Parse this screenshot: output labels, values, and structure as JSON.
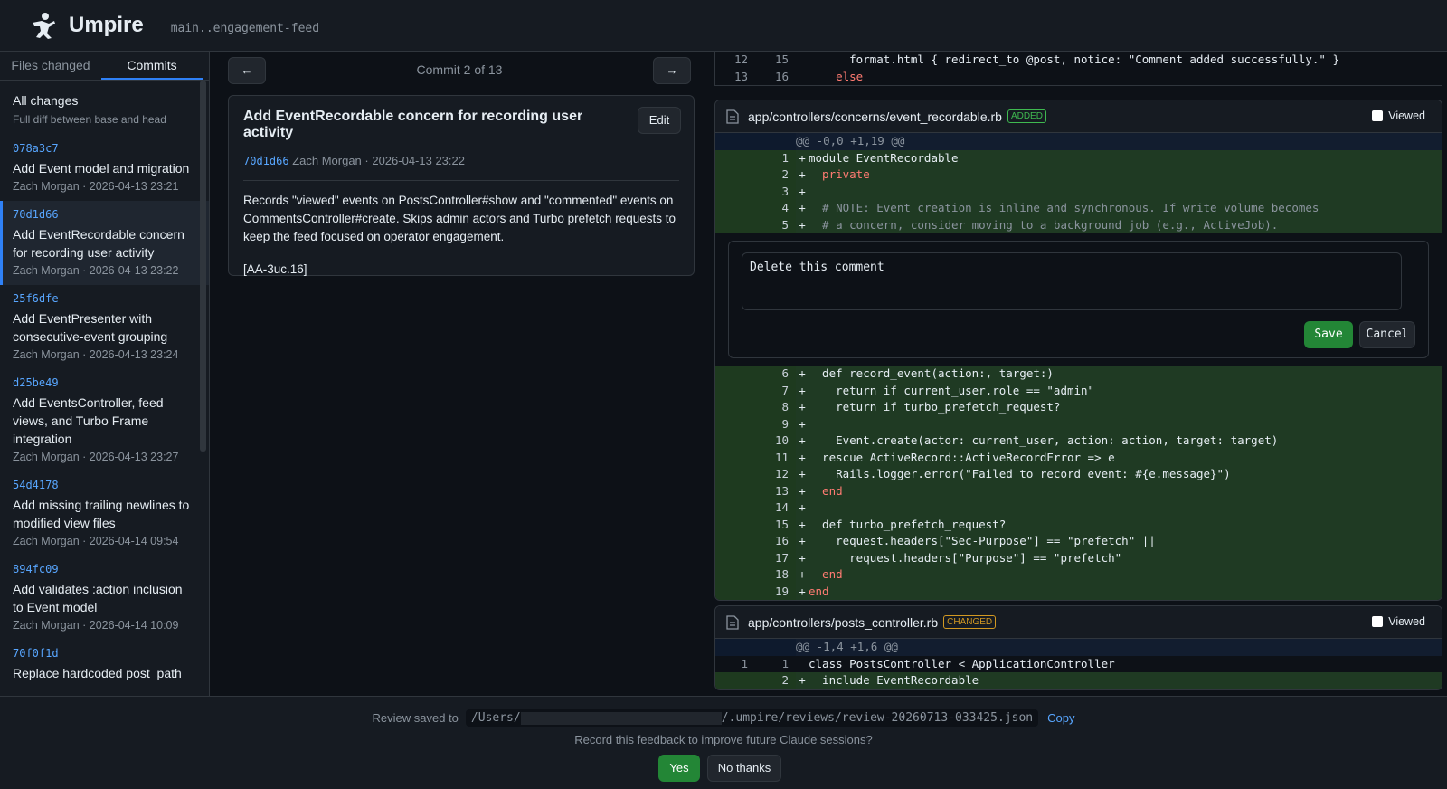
{
  "header": {
    "title": "Umpire",
    "branch": "main..engagement-feed",
    "logo_icon": "umpire-logo-icon"
  },
  "sidebar": {
    "tabs": [
      {
        "label": "Files changed"
      },
      {
        "label": "Commits"
      }
    ],
    "all_changes": {
      "title": "All changes",
      "subtitle": "Full diff between base and head"
    },
    "commits": [
      {
        "hash": "078a3c7",
        "message": "Add Event model and migration",
        "meta": "Zach Morgan · 2026-04-13 23:21"
      },
      {
        "hash": "70d1d66",
        "message": "Add EventRecordable concern for recording user activity",
        "meta": "Zach Morgan · 2026-04-13 23:22"
      },
      {
        "hash": "25f6dfe",
        "message": "Add EventPresenter with consecutive-event grouping",
        "meta": "Zach Morgan · 2026-04-13 23:24"
      },
      {
        "hash": "d25be49",
        "message": "Add EventsController, feed views, and Turbo Frame integration",
        "meta": "Zach Morgan · 2026-04-13 23:27"
      },
      {
        "hash": "54d4178",
        "message": "Add missing trailing newlines to modified view files",
        "meta": "Zach Morgan · 2026-04-14 09:54"
      },
      {
        "hash": "894fc09",
        "message": "Add validates :action inclusion to Event model",
        "meta": "Zach Morgan · 2026-04-14 10:09"
      },
      {
        "hash": "70f0f1d",
        "message": "Replace hardcoded post_path",
        "meta": ""
      }
    ]
  },
  "middle": {
    "prev_label": "←",
    "next_label": "→",
    "commit_count": "Commit 2 of 13",
    "commit": {
      "title": "Add EventRecordable concern for recording user activity",
      "edit_label": "Edit",
      "hash": "70d1d66",
      "meta": " Zach Morgan · 2026-04-13 23:22",
      "body": "Records \"viewed\" events on PostsController#show and \"commented\" events on CommentsController#create. Skips admin actors and Turbo prefetch requests to keep the feed focused on operator engagement.",
      "tag": "[AA-3uc.16]"
    }
  },
  "diff": {
    "top_lines": [
      {
        "old": "12",
        "new": "15",
        "text": "      format.html { redirect_to @post, notice: \"Comment added successfully.\" }"
      },
      {
        "old": "13",
        "new": "16",
        "text": "    else"
      }
    ],
    "file1": {
      "path": "app/controllers/concerns/event_recordable.rb",
      "badge": "ADDED",
      "viewed_label": "Viewed",
      "hunk": "@@ -0,0 +1,19 @@",
      "lines_a": [
        {
          "n": "1",
          "text": "module EventRecordable"
        },
        {
          "n": "2",
          "text": "  private"
        },
        {
          "n": "3",
          "text": ""
        },
        {
          "n": "4",
          "text": "  # NOTE: Event creation is inline and synchronous. If write volume becomes"
        },
        {
          "n": "5",
          "text": "  # a concern, consider moving to a background job (e.g., ActiveJob)."
        }
      ],
      "comment": {
        "value": "Delete this comment",
        "save_label": "Save",
        "cancel_label": "Cancel"
      },
      "lines_b": [
        {
          "n": "6",
          "text": "  def record_event(action:, target:)"
        },
        {
          "n": "7",
          "text": "    return if current_user.role == \"admin\""
        },
        {
          "n": "8",
          "text": "    return if turbo_prefetch_request?"
        },
        {
          "n": "9",
          "text": ""
        },
        {
          "n": "10",
          "text": "    Event.create(actor: current_user, action: action, target: target)"
        },
        {
          "n": "11",
          "text": "  rescue ActiveRecord::ActiveRecordError => e"
        },
        {
          "n": "12",
          "text": "    Rails.logger.error(\"Failed to record event: #{e.message}\")"
        },
        {
          "n": "13",
          "text": "  end"
        },
        {
          "n": "14",
          "text": ""
        },
        {
          "n": "15",
          "text": "  def turbo_prefetch_request?"
        },
        {
          "n": "16",
          "text": "    request.headers[\"Sec-Purpose\"] == \"prefetch\" ||"
        },
        {
          "n": "17",
          "text": "      request.headers[\"Purpose\"] == \"prefetch\""
        },
        {
          "n": "18",
          "text": "  end"
        },
        {
          "n": "19",
          "text": "end"
        }
      ]
    },
    "file2": {
      "path": "app/controllers/posts_controller.rb",
      "badge": "CHANGED",
      "viewed_label": "Viewed",
      "hunk": "@@ -1,4 +1,6 @@",
      "ctx_line": {
        "old": "1",
        "new": "1",
        "text": "class PostsController < ApplicationController"
      },
      "add_line": {
        "new": "2",
        "text": "  include EventRecordable"
      }
    }
  },
  "footer": {
    "saved_prefix": "Review saved to",
    "path_start": "/Users/",
    "path_end": "/.umpire/reviews/review-20260713-033425.json",
    "copy_label": "Copy",
    "question": "Record this feedback to improve future Claude sessions?",
    "yes_label": "Yes",
    "no_label": "No thanks"
  },
  "colors": {
    "accent": "#2f81f7",
    "add_bg": "#1f3a23",
    "save_green": "#238636",
    "added_badge": "#3fb950",
    "changed_badge": "#d29922"
  }
}
